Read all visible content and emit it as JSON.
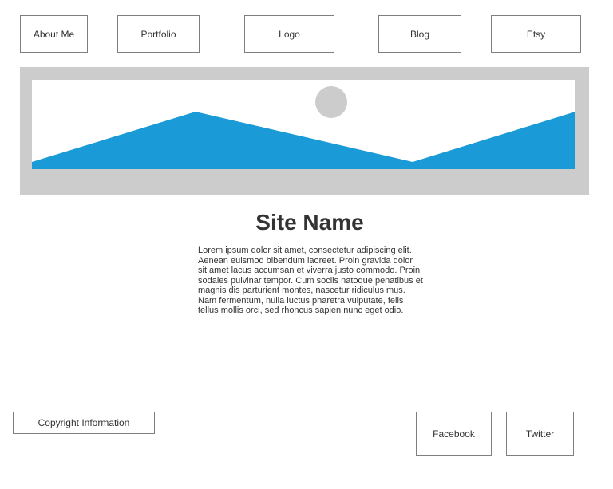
{
  "nav": {
    "about": "About Me",
    "portfolio": "Portfolio",
    "logo": "Logo",
    "blog": "Blog",
    "etsy": "Etsy"
  },
  "hero": {
    "icon": "image-placeholder-icon",
    "frame_color": "#cccccc",
    "mountain_color": "#1a9ad6",
    "sun_color": "#cccccc"
  },
  "main": {
    "site_name": "Site Name",
    "body": "Lorem ipsum dolor sit amet, consectetur adipiscing elit. Aenean euismod bibendum laoreet. Proin gravida dolor sit amet lacus accumsan et viverra justo commodo. Proin sodales pulvinar tempor. Cum sociis natoque penatibus et magnis dis parturient montes, nascetur ridiculus mus. Nam fermentum, nulla luctus pharetra vulputate, felis tellus mollis orci, sed rhoncus sapien nunc eget odio."
  },
  "footer": {
    "copyright": "Copyright Information",
    "facebook": "Facebook",
    "twitter": "Twitter"
  }
}
